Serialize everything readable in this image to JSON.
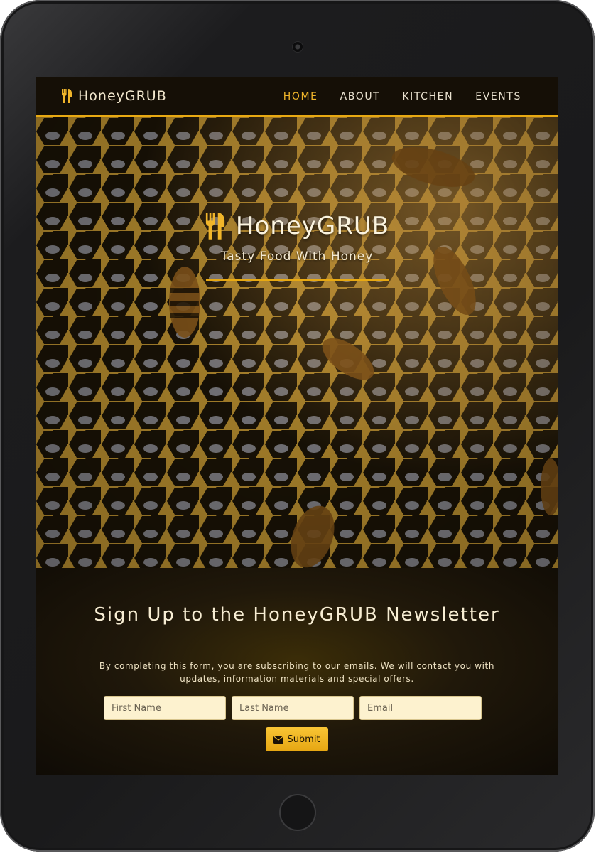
{
  "brand": {
    "name": "HoneyGRUB"
  },
  "nav": {
    "items": [
      {
        "label": "Home",
        "active": true
      },
      {
        "label": "About",
        "active": false
      },
      {
        "label": "Kitchen",
        "active": false
      },
      {
        "label": "Events",
        "active": false
      }
    ]
  },
  "hero": {
    "title": "HoneyGRUB",
    "subtitle": "Tasty Food With Honey"
  },
  "newsletter": {
    "title": "Sign Up to the HoneyGRUB Newsletter",
    "description": "By completing this form, you are subscribing to our emails. We will contact you with updates, information materials and special offers.",
    "first_name_placeholder": "First Name",
    "last_name_placeholder": "Last Name",
    "email_placeholder": "Email",
    "submit_label": "Submit"
  },
  "colors": {
    "accent": "#e8a912",
    "dark": "#100c05",
    "input_bg": "#fdf2cf"
  },
  "icons": {
    "brand": "utensils-icon",
    "submit": "envelope-icon"
  }
}
